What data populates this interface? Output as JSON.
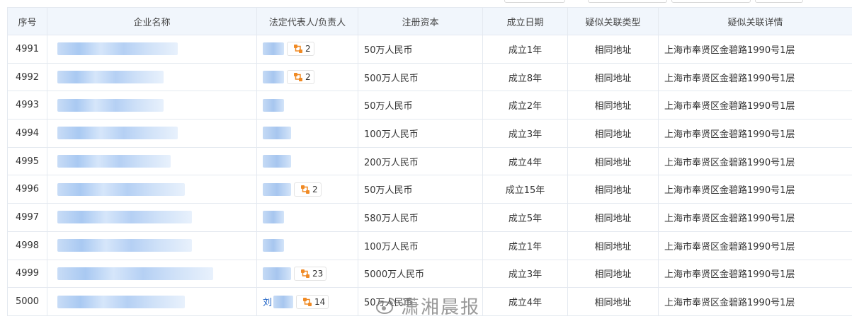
{
  "table": {
    "headers": [
      "序号",
      "企业名称",
      "法定代表人/负责人",
      "注册资本",
      "成立日期",
      "疑似关联类型",
      "疑似关联详情"
    ],
    "rows": [
      {
        "idx": "4991",
        "person_prefix": "",
        "rel_count": "2",
        "capital": "50万人民币",
        "founded": "成立1年",
        "rel_type": "相同地址",
        "detail": "上海市奉贤区金碧路1990号1层"
      },
      {
        "idx": "4992",
        "person_prefix": "",
        "rel_count": "2",
        "capital": "500万人民币",
        "founded": "成立8年",
        "rel_type": "相同地址",
        "detail": "上海市奉贤区金碧路1990号1层"
      },
      {
        "idx": "4993",
        "person_prefix": "",
        "rel_count": "",
        "capital": "50万人民币",
        "founded": "成立2年",
        "rel_type": "相同地址",
        "detail": "上海市奉贤区金碧路1990号1层"
      },
      {
        "idx": "4994",
        "person_prefix": "",
        "rel_count": "",
        "capital": "100万人民币",
        "founded": "成立3年",
        "rel_type": "相同地址",
        "detail": "上海市奉贤区金碧路1990号1层"
      },
      {
        "idx": "4995",
        "person_prefix": "",
        "rel_count": "",
        "capital": "200万人民币",
        "founded": "成立4年",
        "rel_type": "相同地址",
        "detail": "上海市奉贤区金碧路1990号1层"
      },
      {
        "idx": "4996",
        "person_prefix": "",
        "rel_count": "2",
        "capital": "50万人民币",
        "founded": "成立15年",
        "rel_type": "相同地址",
        "detail": "上海市奉贤区金碧路1990号1层"
      },
      {
        "idx": "4997",
        "person_prefix": "",
        "rel_count": "",
        "capital": "580万人民币",
        "founded": "成立5年",
        "rel_type": "相同地址",
        "detail": "上海市奉贤区金碧路1990号1层"
      },
      {
        "idx": "4998",
        "person_prefix": "",
        "rel_count": "",
        "capital": "100万人民币",
        "founded": "成立1年",
        "rel_type": "相同地址",
        "detail": "上海市奉贤区金碧路1990号1层"
      },
      {
        "idx": "4999",
        "person_prefix": "",
        "rel_count": "23",
        "capital": "5000万人民币",
        "founded": "成立3年",
        "rel_type": "相同地址",
        "detail": "上海市奉贤区金碧路1990号1层"
      },
      {
        "idx": "5000",
        "person_prefix": "刘",
        "rel_count": "14",
        "capital": "50万人民币",
        "founded": "成立4年",
        "rel_type": "相同地址",
        "detail": "上海市奉贤区金碧路1990号1层"
      }
    ]
  },
  "watermark": {
    "text": "潇湘晨报",
    "icon": "weibo-logo-icon"
  },
  "colors": {
    "header_bg": "#f1f6fc",
    "border": "#e4e9f0",
    "link": "#1f63c6",
    "relation_icon": "#f08a24"
  }
}
